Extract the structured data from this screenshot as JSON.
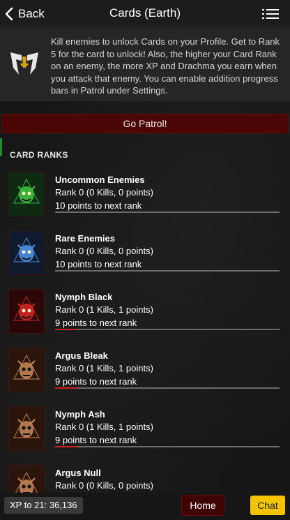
{
  "header": {
    "back_label": "Back",
    "title": "Cards (Earth)",
    "back_icon": "chevron-left-icon",
    "menu_icon": "menu-icon"
  },
  "info": {
    "logo_icon": "guild-emblem-icon",
    "text": "Kill enemies to unlock Cards on your Profile. Get to Rank 5 for the card to unlock! Also, the higher your Card Rank on an enemy, the more XP and Drachma you earn when you attack that enemy. You can enable addition progress bars in Patrol under Settings."
  },
  "patrol_button": "Go Patrol!",
  "section_title": "CARD RANKS",
  "cards": [
    {
      "name": "Uncommon Enemies",
      "rank": "Rank 0 (0 Kills, 0 points)",
      "next": "10 points to next rank",
      "progress": 0,
      "color": "#3fbf3f",
      "bg": "#0f2a12",
      "icon": "green-demon-icon"
    },
    {
      "name": "Rare Enemies",
      "rank": "Rank 0 (0 Kills, 0 points)",
      "next": "10 points to next rank",
      "progress": 0,
      "color": "#4f8fe0",
      "bg": "#0f1a2e",
      "icon": "blue-demon-icon"
    },
    {
      "name": "Nymph Black",
      "rank": "Rank 0 (1 Kills, 1 points)",
      "next": "9 points to next rank",
      "progress": 0.1,
      "color": "#d02525",
      "bg": "#2a0808",
      "icon": "red-demon-icon"
    },
    {
      "name": "Argus Bleak",
      "rank": "Rank 0 (1 Kills, 1 points)",
      "next": "9 points to next rank",
      "progress": 0.1,
      "color": "#c98a5a",
      "bg": "#2a140c",
      "icon": "copper-skull-icon"
    },
    {
      "name": "Nymph Ash",
      "rank": "Rank 0 (1 Kills, 1 points)",
      "next": "9 points to next rank",
      "progress": 0.1,
      "color": "#c98a5a",
      "bg": "#2a140c",
      "icon": "copper-skull-icon"
    },
    {
      "name": "Argus Null",
      "rank": "Rank 0 (0 Kills, 0 points)",
      "next": "",
      "progress": 0,
      "color": "#c98a5a",
      "bg": "#2a140c",
      "icon": "copper-skull-icon"
    }
  ],
  "footer": {
    "xp": "XP to 21: 36,136",
    "home": "Home",
    "chat": "Chat"
  }
}
